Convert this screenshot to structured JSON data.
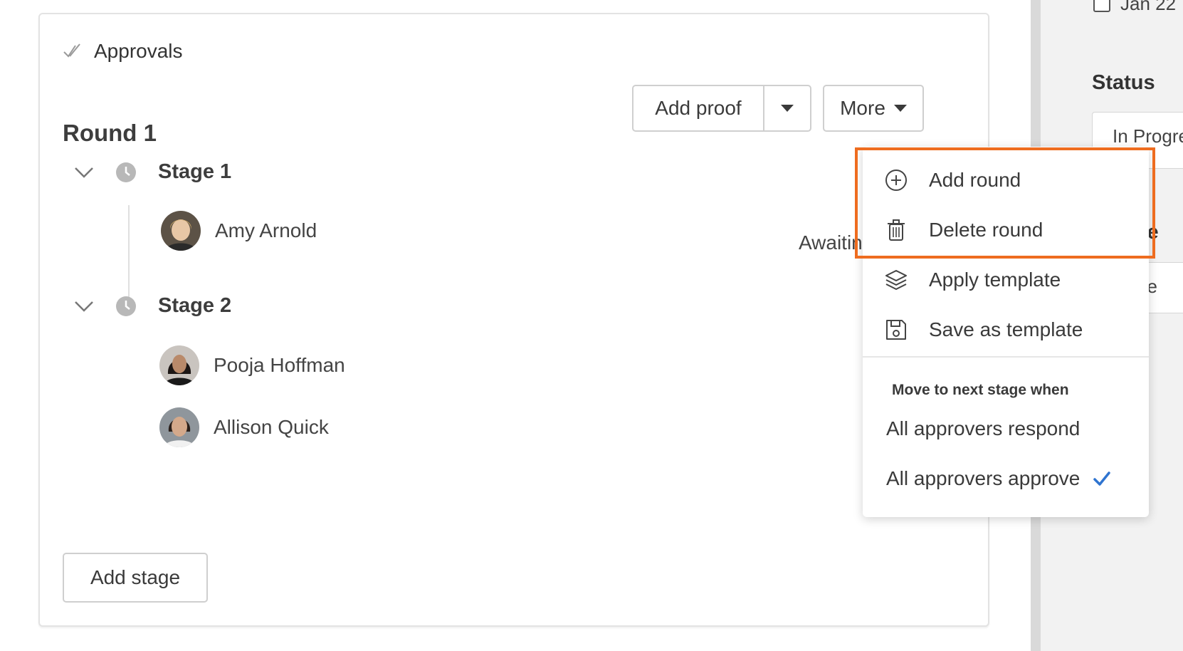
{
  "side_panel": {
    "date_text": "Jan 22",
    "status_label": "Status",
    "status_value": "In Progress",
    "field2_label": "ty Le",
    "field2_value": "ne"
  },
  "card": {
    "title": "Approvals",
    "round_title": "Round 1",
    "add_proof_label": "Add proof",
    "more_label": "More",
    "add_stage_label": "Add stage"
  },
  "stages": [
    {
      "label": "Stage 1",
      "people": [
        {
          "name": "Amy Arnold",
          "status": "Awaitin"
        }
      ]
    },
    {
      "label": "Stage 2",
      "people": [
        {
          "name": "Pooja Hoffman"
        },
        {
          "name": "Allison Quick"
        }
      ]
    }
  ],
  "menu": {
    "items": [
      {
        "label": "Add round",
        "icon": "plus-circle-icon"
      },
      {
        "label": "Delete round",
        "icon": "trash-icon"
      },
      {
        "label": "Apply template",
        "icon": "layers-icon"
      },
      {
        "label": "Save as template",
        "icon": "save-icon"
      }
    ],
    "section_title": "Move to next stage when",
    "options": [
      {
        "label": "All approvers respond",
        "selected": false
      },
      {
        "label": "All approvers approve",
        "selected": true
      }
    ]
  },
  "colors": {
    "highlight": "#ee6c1f",
    "check": "#2f74d0",
    "muted_icon": "#9a9a9a"
  }
}
